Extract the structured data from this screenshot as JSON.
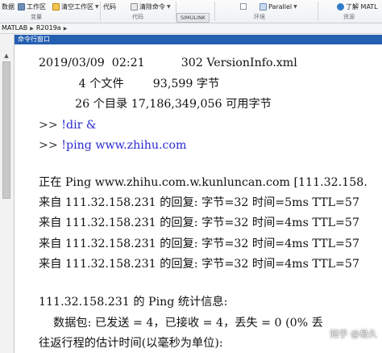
{
  "toolstrip": {
    "buttons": [
      {
        "label": "数据"
      },
      {
        "label": "工作区"
      },
      {
        "label": "清空工作区"
      },
      {
        "label": "代码"
      },
      {
        "label": "清除命令"
      },
      {
        "label": "Parallel"
      },
      {
        "label": "了解 MATL"
      }
    ],
    "sections": [
      "变量",
      "代码",
      "SIMULINK",
      "环境",
      "资源"
    ]
  },
  "pathbar": {
    "crumbs": [
      "MATLAB",
      "R2019a"
    ]
  },
  "panel": {
    "title": "命令行窗口"
  },
  "console": {
    "lines": [
      {
        "text": "2019/03/09  02:21          302 VersionInfo.xml"
      },
      {
        "text": "           4 个文件        93,599 字节"
      },
      {
        "text": "          26 个目录 17,186,349,056 可用字节"
      },
      {
        "prompt": ">> ",
        "cmd": "!dir &"
      },
      {
        "prompt": ">> ",
        "cmd": "!ping www.zhihu.com"
      },
      {
        "text": "正在 Ping www.zhihu.com.w.kunluncan.com [111.32.158."
      },
      {
        "text": "来自 111.32.158.231 的回复: 字节=32 时间=5ms TTL=57"
      },
      {
        "text": "来自 111.32.158.231 的回复: 字节=32 时间=4ms TTL=57"
      },
      {
        "text": "来自 111.32.158.231 的回复: 字节=32 时间=4ms TTL=57"
      },
      {
        "text": "来自 111.32.158.231 的回复: 字节=32 时间=4ms TTL=57"
      },
      {
        "text": "111.32.158.231 的 Ping 统计信息:"
      },
      {
        "text": "    数据包: 已发送 = 4，已接收 = 4，丢失 = 0 (0% 丢"
      },
      {
        "text": "往返行程的估计时间(以毫秒为单位):"
      }
    ]
  },
  "watermark": "知乎 @易久",
  "colors": {
    "panel_title_bg": "#245fb0",
    "command_text": "#2b2bd1"
  }
}
